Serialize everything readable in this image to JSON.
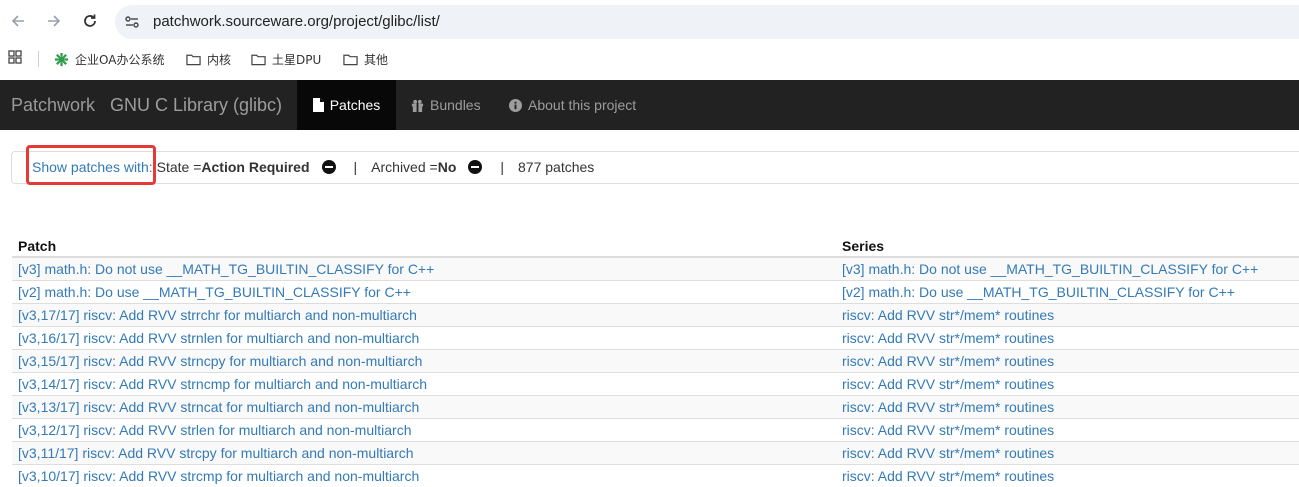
{
  "browser": {
    "url": "patchwork.sourceware.org/project/glibc/list/",
    "bookmarks": [
      {
        "label": "企业OA办公系统",
        "icon": "gear-flower-icon"
      },
      {
        "label": "内核",
        "icon": "folder-icon"
      },
      {
        "label": "土星DPU",
        "icon": "folder-icon"
      },
      {
        "label": "其他",
        "icon": "folder-icon"
      }
    ]
  },
  "navbar": {
    "brand": "Patchwork",
    "project": "GNU C Library (glibc)",
    "items": [
      {
        "label": "Patches",
        "icon": "file-icon",
        "active": true
      },
      {
        "label": "Bundles",
        "icon": "gift-icon",
        "active": false
      },
      {
        "label": "About this project",
        "icon": "info-icon",
        "active": false
      }
    ]
  },
  "filter": {
    "show_label": "Show patches with:",
    "state_prefix": "State = ",
    "state_value": "Action Required",
    "separator": "|",
    "archived_prefix": "Archived = ",
    "archived_value": "No",
    "count": "877 patches"
  },
  "table": {
    "headers": [
      "Patch",
      "Series"
    ],
    "rows": [
      {
        "patch": "[v3] math.h: Do not use __MATH_TG_BUILTIN_CLASSIFY for C++",
        "series": "[v3] math.h: Do not use __MATH_TG_BUILTIN_CLASSIFY for C++"
      },
      {
        "patch": "[v2] math.h: Do use __MATH_TG_BUILTIN_CLASSIFY for C++",
        "series": "[v2] math.h: Do use __MATH_TG_BUILTIN_CLASSIFY for C++"
      },
      {
        "patch": "[v3,17/17] riscv: Add RVV strrchr for multiarch and non-multiarch",
        "series": "riscv: Add RVV str*/mem* routines"
      },
      {
        "patch": "[v3,16/17] riscv: Add RVV strnlen for multiarch and non-multiarch",
        "series": "riscv: Add RVV str*/mem* routines"
      },
      {
        "patch": "[v3,15/17] riscv: Add RVV strncpy for multiarch and non-multiarch",
        "series": "riscv: Add RVV str*/mem* routines"
      },
      {
        "patch": "[v3,14/17] riscv: Add RVV strncmp for multiarch and non-multiarch",
        "series": "riscv: Add RVV str*/mem* routines"
      },
      {
        "patch": "[v3,13/17] riscv: Add RVV strncat for multiarch and non-multiarch",
        "series": "riscv: Add RVV str*/mem* routines"
      },
      {
        "patch": "[v3,12/17] riscv: Add RVV strlen for multiarch and non-multiarch",
        "series": "riscv: Add RVV str*/mem* routines"
      },
      {
        "patch": "[v3,11/17] riscv: Add RVV strcpy for multiarch and non-multiarch",
        "series": "riscv: Add RVV str*/mem* routines"
      },
      {
        "patch": "[v3,10/17] riscv: Add RVV strcmp for multiarch and non-multiarch",
        "series": "riscv: Add RVV str*/mem* routines"
      }
    ]
  },
  "colors": {
    "navbar_bg": "#222222",
    "navbar_active_bg": "#080808",
    "link": "#337ab7",
    "highlight": "#e53935"
  }
}
